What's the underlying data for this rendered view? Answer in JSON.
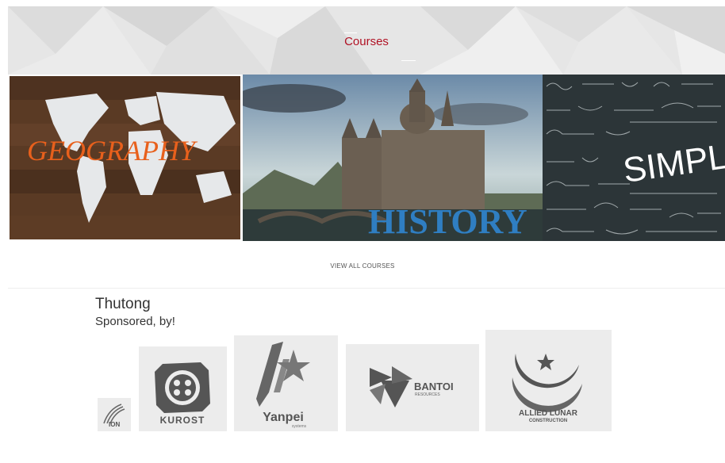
{
  "banner": {
    "title": "Courses"
  },
  "courses": [
    {
      "label": "GEOGRAPHY",
      "label_color": "#e8601c"
    },
    {
      "label": "HISTORY",
      "label_color": "#2f7ec2"
    },
    {
      "label": "SIMPLE M",
      "label_color": "#ffffff"
    }
  ],
  "view_all": "VIEW ALL COURSES",
  "org": {
    "name": "Thutong",
    "sponsored_label": "Sponsored, by!"
  },
  "sponsors": [
    {
      "name": "ION"
    },
    {
      "name": "KUROST"
    },
    {
      "name": "Yanpei",
      "tagline": "systems"
    },
    {
      "name": "BANTOI",
      "tagline": "RESOURCES"
    },
    {
      "name": "ALLIED LUNAR",
      "tagline": "CONSTRUCTION"
    }
  ],
  "colors": {
    "accent_red": "#b01224",
    "logo_gray": "#555555",
    "banner_bg": "#e4e4e4"
  }
}
